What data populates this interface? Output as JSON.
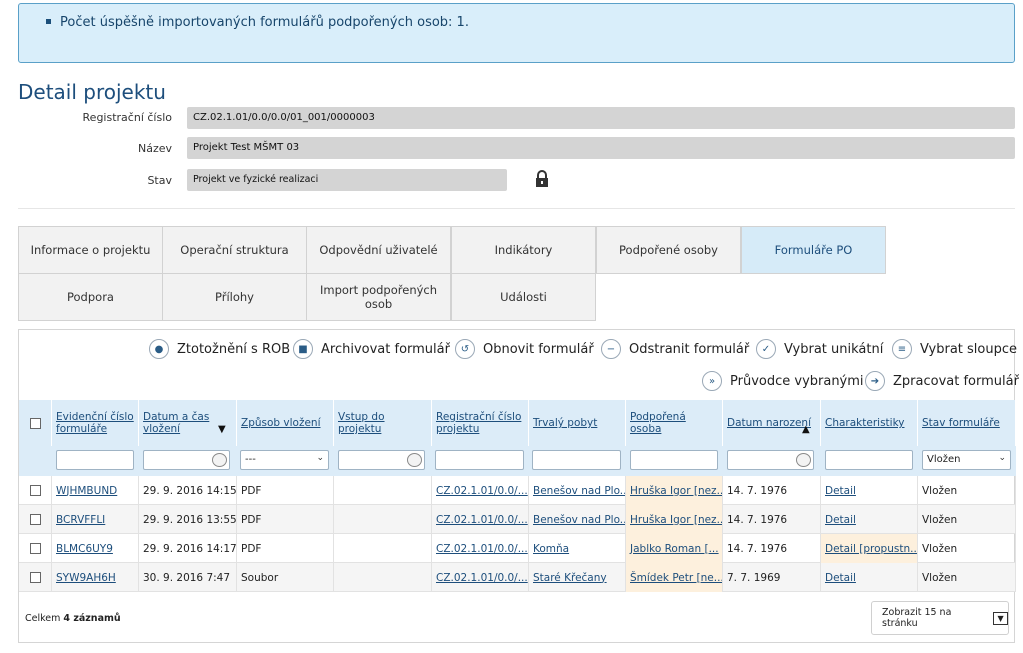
{
  "notice": {
    "message": "Počet úspěšně importovaných formulářů podpořených osob: 1."
  },
  "page": {
    "title": "Detail projektu"
  },
  "fields": [
    {
      "label": "Registrační číslo",
      "value": "CZ.02.1.01/0.0/0.0/01_001/0000003"
    },
    {
      "label": "Název",
      "value": "Projekt Test MŠMT 03"
    },
    {
      "label": "Stav",
      "value": "Projekt ve fyzické realizaci"
    }
  ],
  "tabs": [
    {
      "label": "Informace o projektu"
    },
    {
      "label": "Operační struktura"
    },
    {
      "label": "Odpovědní uživatelé"
    },
    {
      "label": "Indikátory"
    },
    {
      "label": "Podpořené osoby"
    },
    {
      "label": "Formuláře PO",
      "active": true
    },
    {
      "label": "Podpora"
    },
    {
      "label": "Přílohy"
    },
    {
      "label": "Import podpořených osob"
    },
    {
      "label": "Události"
    }
  ],
  "toolbar": {
    "identify": "Ztotožnění s ROB",
    "archive": "Archivovat formulář",
    "restore": "Obnovit formulář",
    "remove": "Odstranit formulář",
    "select_unique": "Vybrat unikátní",
    "select_columns": "Vybrat sloupce",
    "wizard": "Průvodce vybranými",
    "process": "Zpracovat formulář"
  },
  "table": {
    "columns": [
      "Evidenční číslo formuláře",
      "Datum a čas vložení",
      "Způsob vložení",
      "Vstup do projektu",
      "Registrační číslo projektu",
      "Trvalý pobyt",
      "Podpořená osoba",
      "Datum narození",
      "Charakteristiky",
      "Stav formuláře"
    ],
    "filters": {
      "method": "---",
      "state": "Vložen"
    },
    "rows": [
      {
        "id": "WJHMBUND",
        "date": "29. 9. 2016 14:15",
        "method": "PDF",
        "entry": "",
        "reg": "CZ.02.1.01/0.0/...",
        "residence": "Benešov nad Plo...",
        "person": "Hruška Igor [nez...",
        "birth": "14. 7. 1976",
        "char": "Detail",
        "state": "Vložen"
      },
      {
        "id": "BCRVFFLI",
        "date": "29. 9. 2016 13:55",
        "method": "PDF",
        "entry": "",
        "reg": "CZ.02.1.01/0.0/...",
        "residence": "Benešov nad Plo...",
        "person": "Hruška Igor [nez...",
        "birth": "14. 7. 1976",
        "char": "Detail",
        "state": "Vložen"
      },
      {
        "id": "BLMC6UY9",
        "date": "29. 9. 2016 14:17",
        "method": "PDF",
        "entry": "",
        "reg": "CZ.02.1.01/0.0/...",
        "residence": "Komňa",
        "person": "Jablko Roman [...",
        "birth": "14. 7. 1976",
        "char": "Detail [propustn...",
        "state": "Vložen"
      },
      {
        "id": "SYW9AH6H",
        "date": "30. 9. 2016 7:47",
        "method": "Soubor",
        "entry": "",
        "reg": "CZ.02.1.01/0.0/...",
        "residence": "Staré Křečany",
        "person": "Šmídek Petr [ne...",
        "birth": "7. 7. 1969",
        "char": "Detail",
        "state": "Vložen"
      }
    ]
  },
  "footer": {
    "total_prefix": "Celkem",
    "total_count": "4 záznamů",
    "pager": "Zobrazit 15 na stránku"
  }
}
